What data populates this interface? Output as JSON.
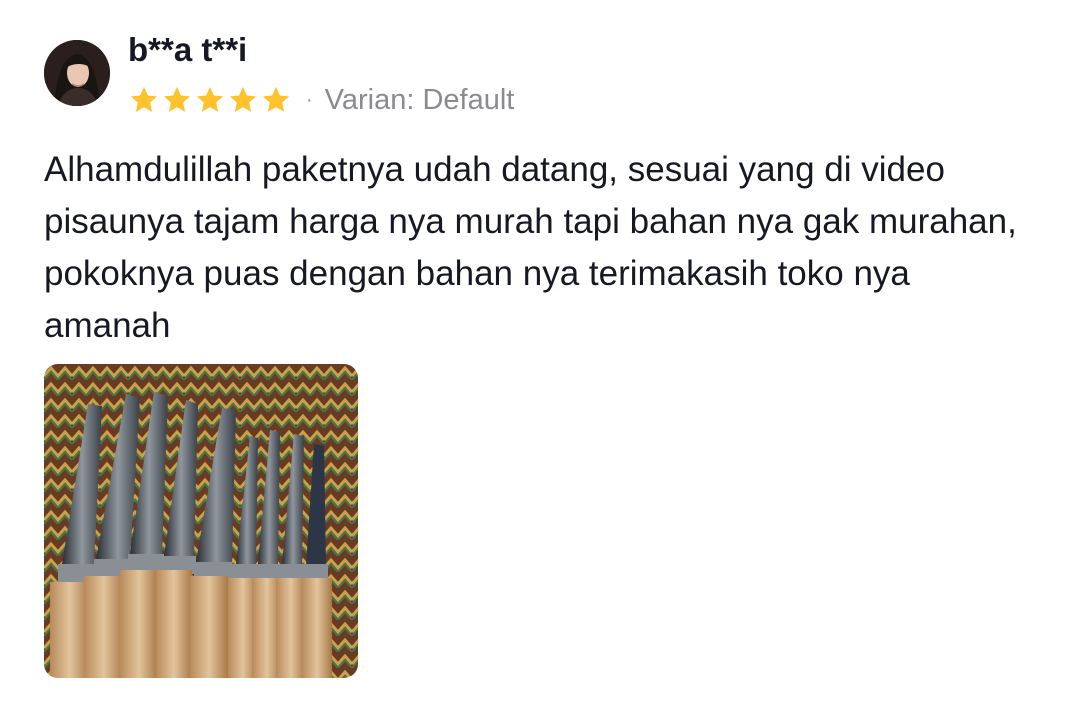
{
  "reviewer": {
    "name": "b**a t**i",
    "avatar_icon": "user-avatar"
  },
  "rating": {
    "stars": 5,
    "max_stars": 5,
    "star_color": "#fdc22c"
  },
  "separator": "·",
  "variant_label": "Varian: Default",
  "comment": "Alhamdulillah paketnya udah datang, sesuai yang di video pisaunya tajam harga nya murah tapi bahan nya gak murahan, pokoknya puas dengan bahan nya terimakasih toko nya amanah",
  "photos": [
    {
      "icon": "knives-photo"
    }
  ]
}
